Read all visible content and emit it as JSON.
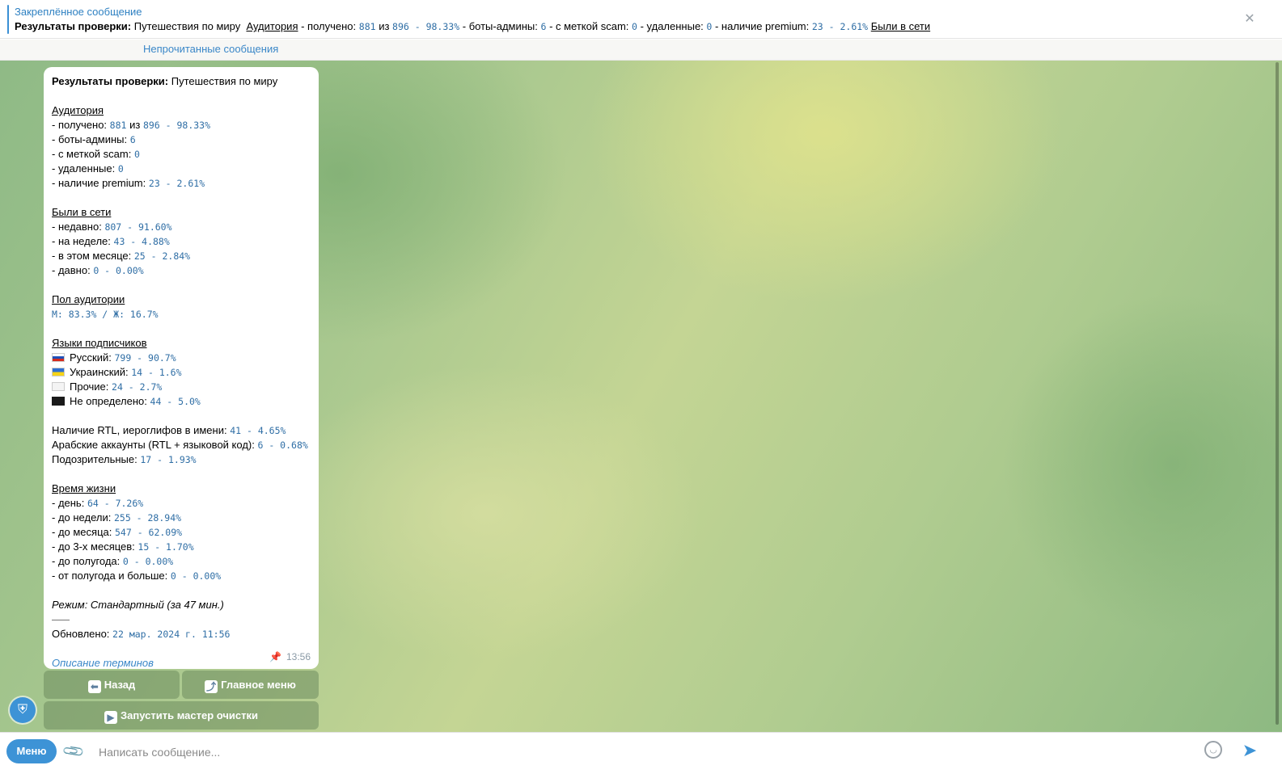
{
  "pinned": {
    "title": "Закреплённое сообщение",
    "bold": "Результаты проверки:",
    "channel": "Путешествия по миру",
    "audience_link": "Аудитория",
    "t1": "- получено:",
    "v1a": "881",
    "iz": "из",
    "v1b": "896 - 98.33%",
    "t2": "- боты-админы:",
    "v2": "6",
    "t3": "- с меткой scam:",
    "v3": "0",
    "t4": "- удаленные:",
    "v4": "0",
    "t5": "- наличие premium:",
    "v5": "23 - 2.61%",
    "online_link": "Были в сети"
  },
  "unread": "Непрочитанные сообщения",
  "message": {
    "title_bold": "Результаты проверки:",
    "title_rest": "Путешествия по миру",
    "audience": {
      "heading": "Аудитория",
      "received_label": "- получено:",
      "received_val": "881",
      "received_of": "из",
      "received_rest": "896 - 98.33%",
      "bots_label": "- боты-админы:",
      "bots_val": "6",
      "scam_label": "- с меткой scam:",
      "scam_val": "0",
      "deleted_label": "- удаленные:",
      "deleted_val": "0",
      "premium_label": "- наличие premium:",
      "premium_val": "23 - 2.61%"
    },
    "online": {
      "heading": "Были в сети",
      "recent_label": "- недавно:",
      "recent_val": "807 - 91.60%",
      "week_label": "- на неделе:",
      "week_val": "43 - 4.88%",
      "month_label": "- в этом месяце:",
      "month_val": "25 - 2.84%",
      "long_label": "- давно:",
      "long_val": "0 - 0.00%"
    },
    "gender": {
      "heading": "Пол аудитории",
      "value": "М: 83.3% / Ж: 16.7%"
    },
    "languages": {
      "heading": "Языки подписчиков",
      "ru_label": "Русский:",
      "ru_val": "799 - 90.7%",
      "ua_label": "Украинский:",
      "ua_val": "14 - 1.6%",
      "other_label": "Прочие:",
      "other_val": "24 - 2.7%",
      "undef_label": "Не определено:",
      "undef_val": "44 - 5.0%"
    },
    "misc": {
      "rtl_label": "Наличие RTL, иероглифов в имени:",
      "rtl_val": "41 - 4.65%",
      "arab_label": "Арабские аккаунты (RTL + языковой код):",
      "arab_val": "6 - 0.68%",
      "susp_label": "Подозрительные:",
      "susp_val": "17 - 1.93%"
    },
    "lifetime": {
      "heading": "Время жизни",
      "day_label": "- день:",
      "day_val": "64 - 7.26%",
      "week_label": "- до недели:",
      "week_val": "255 - 28.94%",
      "month_label": "- до месяца:",
      "month_val": "547 - 62.09%",
      "m3_label": "- до 3-х месяцев:",
      "m3_val": "15 - 1.70%",
      "half_label": "- до полугода:",
      "half_val": "0 - 0.00%",
      "over_label": "- от полугода и больше:",
      "over_val": "0 - 0.00%"
    },
    "mode": "Режим: Стандартный (за 47 мин.)",
    "updated_label": "Обновлено:",
    "updated_val": "22 мар. 2024 г. 11:56",
    "terms_link": "Описание терминов",
    "time": "13:56"
  },
  "keyboard": {
    "back": "Назад",
    "main_menu": "Главное меню",
    "cleanup": "Запустить мастер очистки"
  },
  "composer": {
    "menu": "Меню",
    "placeholder": "Написать сообщение..."
  },
  "colors": {
    "accent": "#3d93d6",
    "link": "#3a87c8",
    "mono": "#2f6ea5"
  }
}
